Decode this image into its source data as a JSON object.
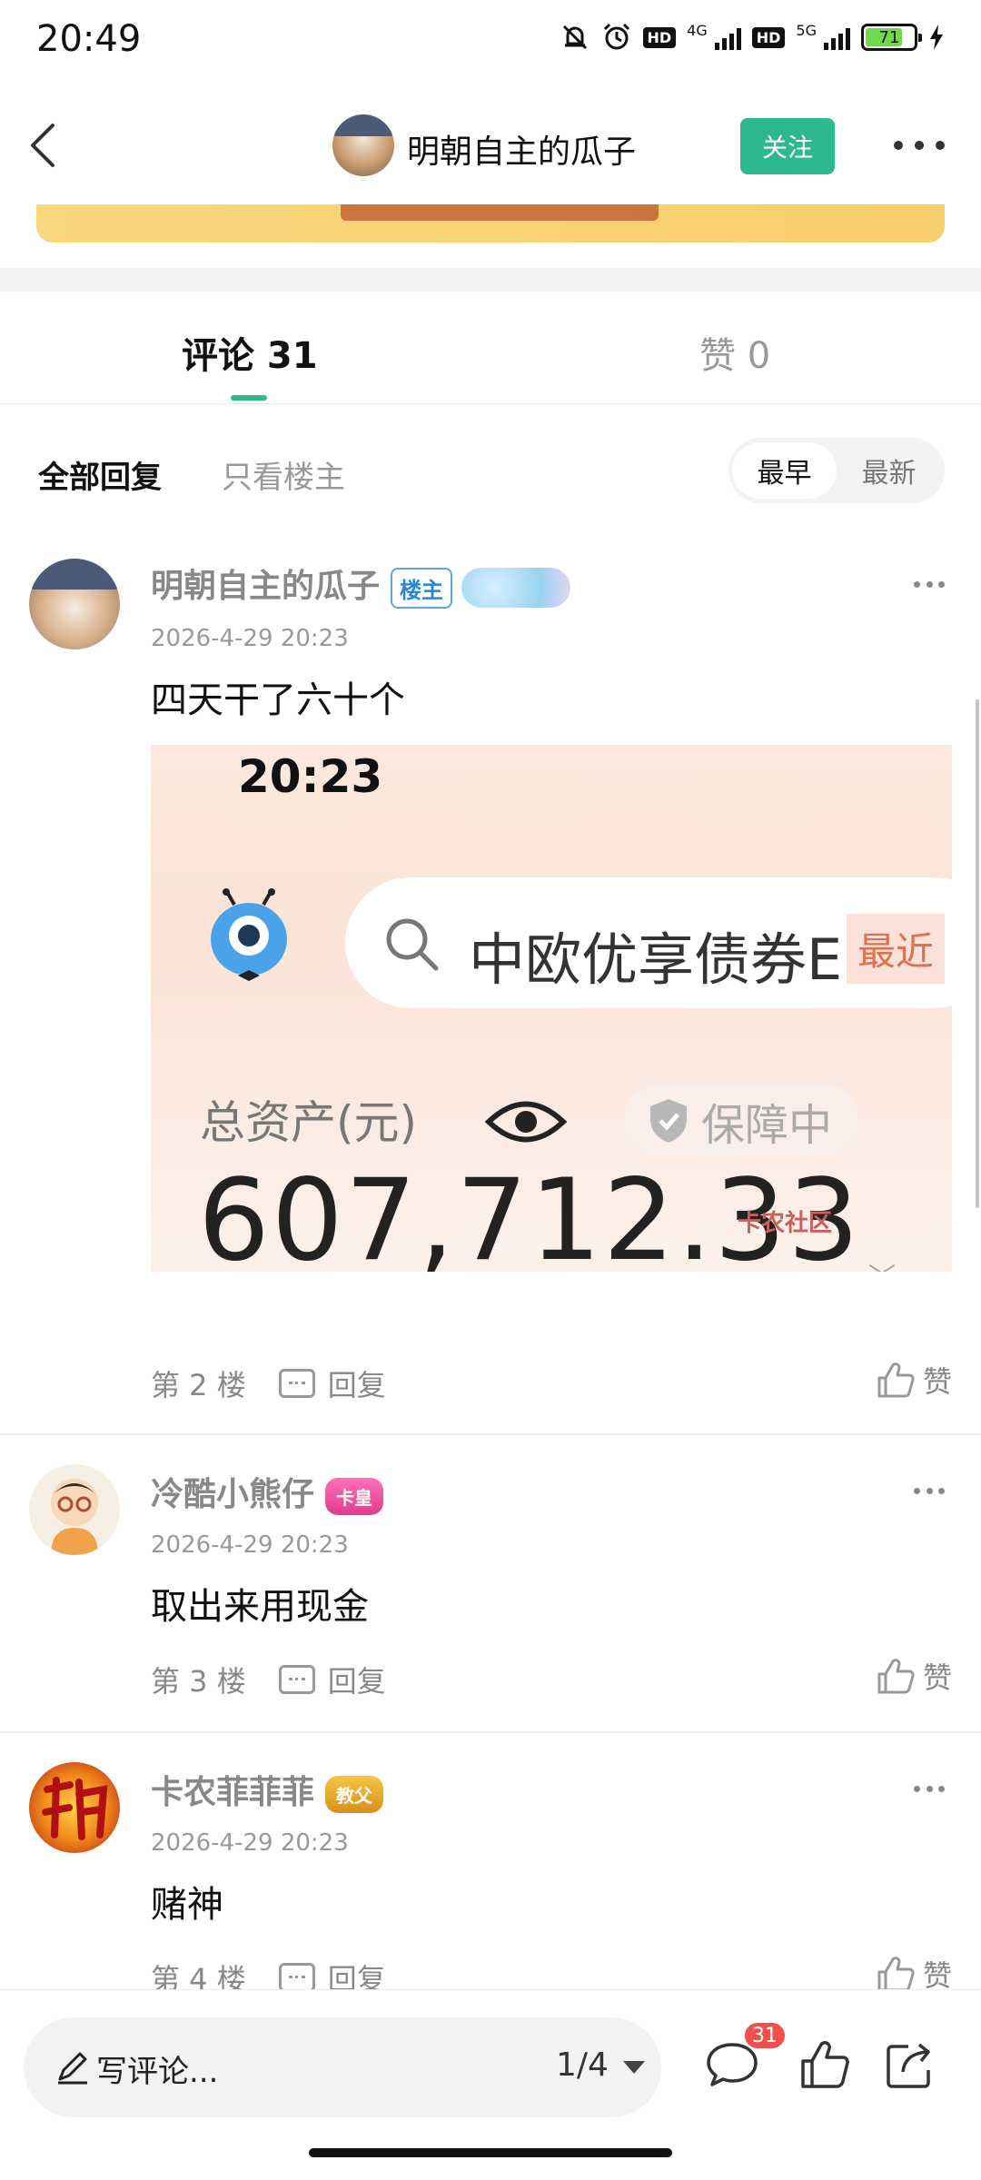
{
  "status_bar": {
    "time": "20:49",
    "network1": "4G",
    "network2": "5G",
    "hd": "HD",
    "battery": "71"
  },
  "header": {
    "author_name": "明朝自主的瓜子",
    "follow_label": "关注"
  },
  "tabs": {
    "comments": "评论 31",
    "likes": "赞 0",
    "accent": "#2db88d"
  },
  "filters": {
    "all": "全部回复",
    "op_only": "只看楼主",
    "sort_earliest": "最早",
    "sort_latest": "最新"
  },
  "comments": [
    {
      "name": "明朝自主的瓜子",
      "badge": "楼主",
      "time": "2026-4-29 20:23",
      "content": "四天干了六十个",
      "floor": "第 2 楼",
      "reply": "回复",
      "like": "赞",
      "image": {
        "time": "20:23",
        "search_text": "中欧优享债券E",
        "search_tag": "最近",
        "asset_label": "总资产(元)",
        "protect": "保障中",
        "amount": "607,712.33",
        "watermark": "卡农社区"
      }
    },
    {
      "name": "冷酷小熊仔",
      "badge": "卡皇",
      "time": "2026-4-29 20:23",
      "content": "取出来用现金",
      "floor": "第 3 楼",
      "reply": "回复",
      "like": "赞"
    },
    {
      "name": "卡农菲菲菲",
      "badge": "教父",
      "time": "2026-4-29 20:23",
      "content": "赌神",
      "floor": "第 4 楼",
      "reply": "回复",
      "like": "赞"
    }
  ],
  "bottom_bar": {
    "placeholder": "写评论...",
    "page": "1/4",
    "comment_count": "31"
  }
}
